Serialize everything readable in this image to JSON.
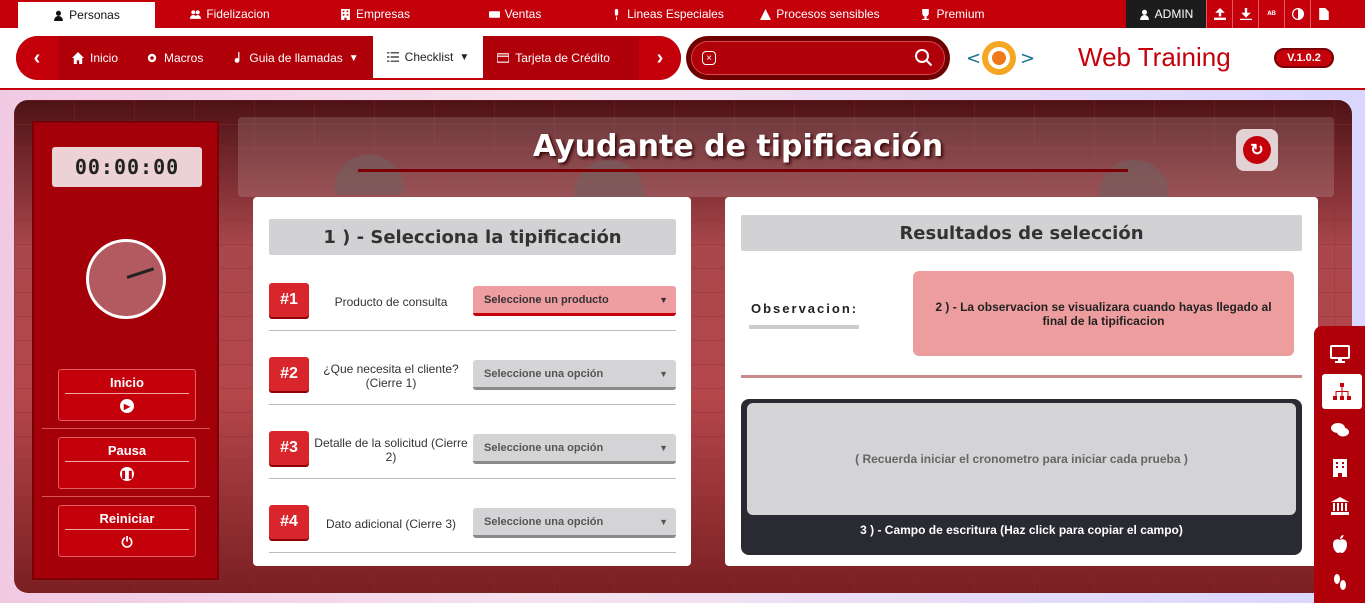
{
  "top_nav": {
    "items": [
      {
        "label": "Personas",
        "icon": "person-icon",
        "active": true
      },
      {
        "label": "Fidelizacion",
        "icon": "users-icon"
      },
      {
        "label": "Empresas",
        "icon": "building-icon"
      },
      {
        "label": "Ventas",
        "icon": "money-icon"
      },
      {
        "label": "Lineas Especiales",
        "icon": "microphone-icon"
      },
      {
        "label": "Procesos sensibles",
        "icon": "warning-icon"
      },
      {
        "label": "Premium",
        "icon": "trophy-icon"
      }
    ],
    "admin_label": "ADMIN",
    "tools": [
      "upload-icon",
      "download-icon",
      "spellcheck-icon",
      "contrast-icon",
      "document-icon"
    ]
  },
  "sub_nav": {
    "items": [
      {
        "label": "Inicio",
        "icon": "home-icon"
      },
      {
        "label": "Macros",
        "icon": "gear-icon"
      },
      {
        "label": "Guia de llamadas",
        "icon": "music-icon",
        "dropdown": true
      },
      {
        "label": "Checklist",
        "icon": "checklist-icon",
        "dropdown": true,
        "active": true
      },
      {
        "label": "Tarjeta de Crédito",
        "icon": "card-icon"
      }
    ],
    "prev": "‹",
    "next": "›"
  },
  "search": {
    "value": "",
    "placeholder": ""
  },
  "brand": {
    "name": "Web Training",
    "version": "V.1.0.2"
  },
  "timer": {
    "display": "00:00:00",
    "buttons": [
      {
        "label": "Inicio",
        "icon": "play-icon"
      },
      {
        "label": "Pausa",
        "icon": "pause-icon"
      },
      {
        "label": "Reiniciar",
        "icon": "power-icon"
      }
    ]
  },
  "main": {
    "title": "Ayudante de tipificación"
  },
  "selection": {
    "heading": "1 ) - Selecciona la tipificación",
    "rows": [
      {
        "num": "#1",
        "label": "Producto de consulta",
        "select": "Seleccione un producto",
        "active": true
      },
      {
        "num": "#2",
        "label": "¿Que necesita el cliente? (Cierre 1)",
        "select": "Seleccione una opción"
      },
      {
        "num": "#3",
        "label": "Detalle de la solicitud (Cierre 2)",
        "select": "Seleccione una opción"
      },
      {
        "num": "#4",
        "label": "Dato adicional (Cierre 3)",
        "select": "Seleccione una opción"
      }
    ]
  },
  "results": {
    "heading": "Resultados de selección",
    "obs_label": "Observacion:",
    "obs_text": "2 ) - La observacion se visualizara cuando hayas llegado al final de la tipificacion",
    "write_hint": "( Recuerda iniciar el cronometro para iniciar cada prueba )",
    "write_footer": "3 ) - Campo de escritura (Haz click para copiar el campo)"
  },
  "dock": [
    "monitor-icon",
    "sitemap-icon",
    "chat-icon",
    "building-icon",
    "bank-icon",
    "apple-icon",
    "steps-icon"
  ]
}
